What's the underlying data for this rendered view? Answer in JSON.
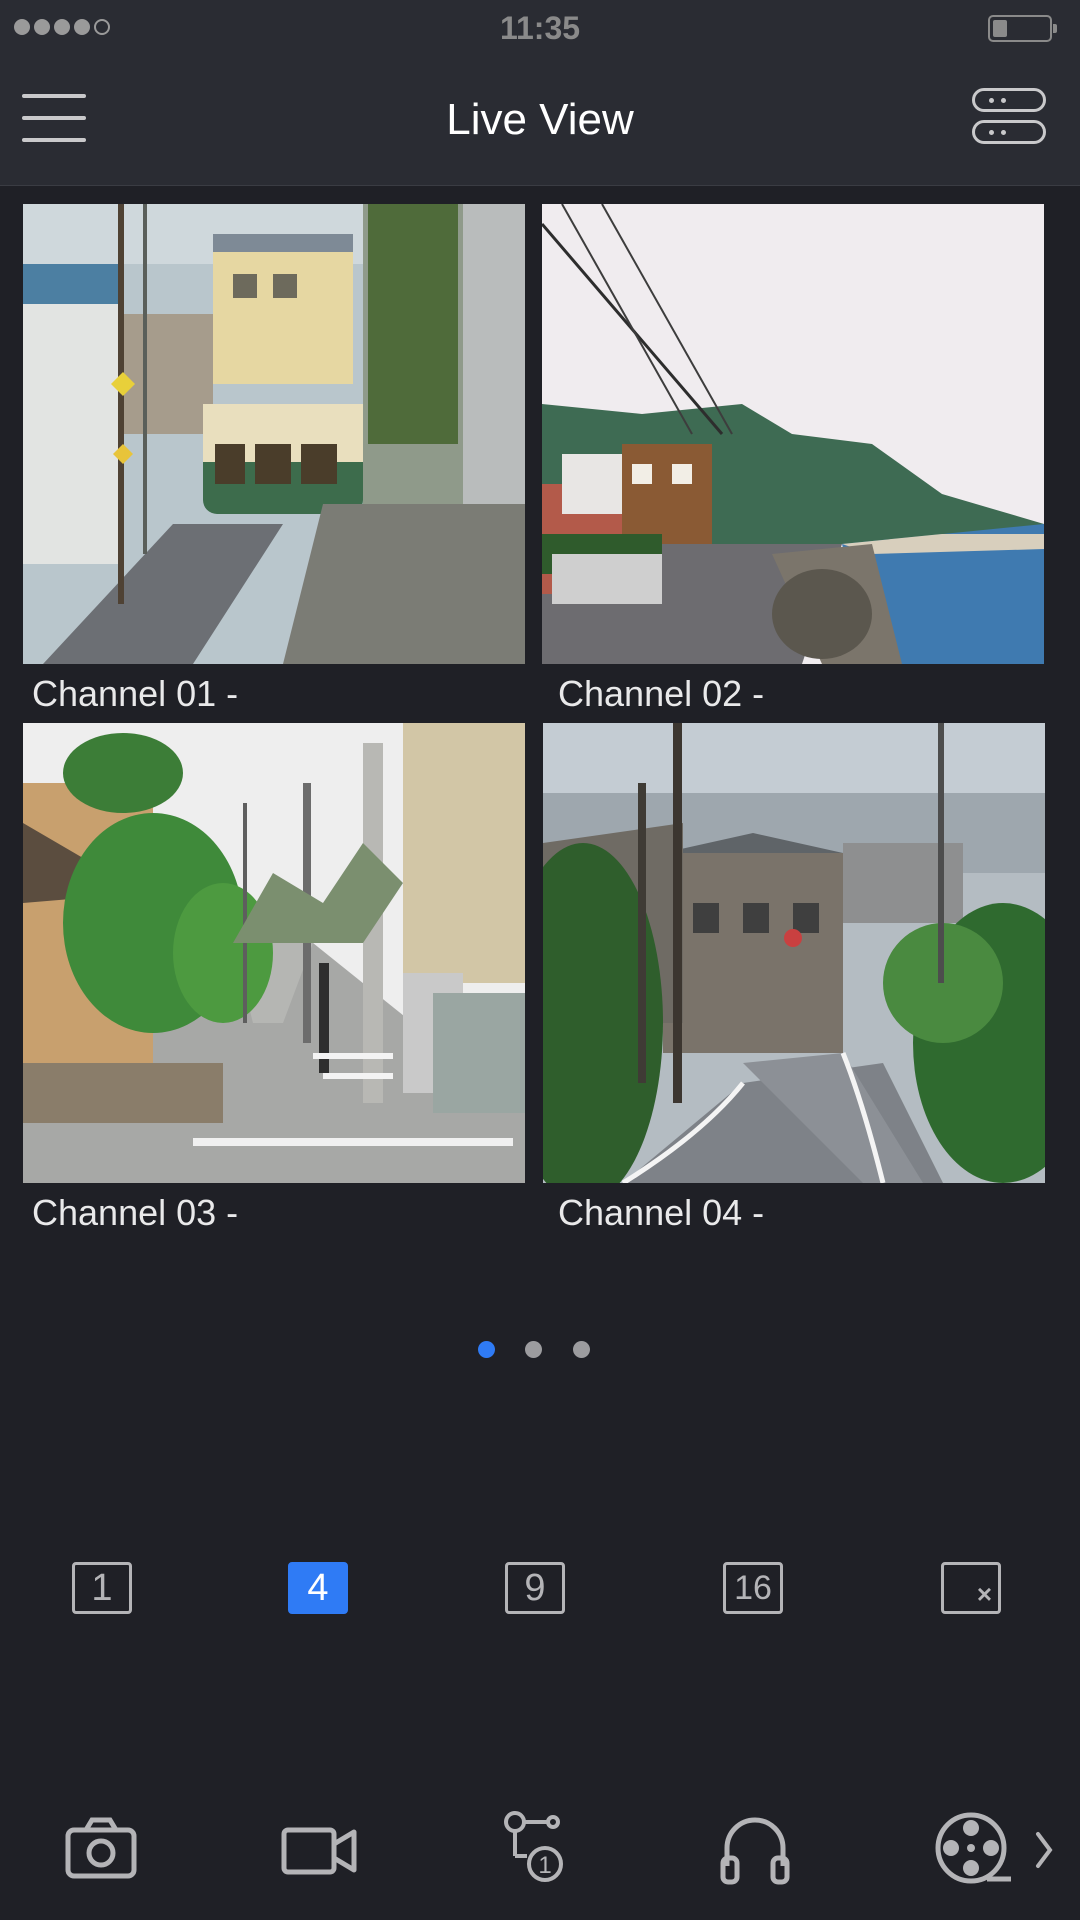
{
  "status_bar": {
    "time": "11:35"
  },
  "header": {
    "title": "Live View"
  },
  "channels": [
    {
      "label": "Channel 01 -"
    },
    {
      "label": "Channel 02 -"
    },
    {
      "label": "Channel 03 -"
    },
    {
      "label": "Channel 04 -"
    }
  ],
  "pager": {
    "pages": 3,
    "active": 1
  },
  "layouts": [
    {
      "label": "1",
      "active": false
    },
    {
      "label": "4",
      "active": true
    },
    {
      "label": "9",
      "active": false
    },
    {
      "label": "16",
      "active": false
    }
  ],
  "toolbar": {
    "icons": [
      "camera-icon",
      "video-record-icon",
      "ptz-icon",
      "headphones-icon",
      "film-reel-icon",
      "chevron-right-icon"
    ]
  },
  "colors": {
    "accent": "#2f7bf5",
    "background": "#1f2026",
    "header": "#2a2c33"
  }
}
